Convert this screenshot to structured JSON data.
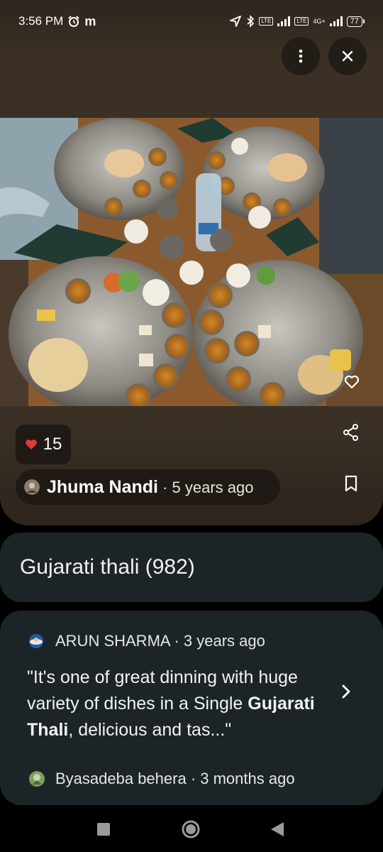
{
  "status_bar": {
    "time": "3:56 PM",
    "notification_letter": "m",
    "network_label": "4G+",
    "lte_label": "LTE",
    "battery": "77"
  },
  "top_actions": {
    "menu_icon": "more-vert-icon",
    "close_icon": "close-icon"
  },
  "photo": {
    "subject": "food-photo"
  },
  "likes": {
    "count": "15"
  },
  "author": {
    "name": "Jhuma Nandi",
    "time": " · 5 years ago"
  },
  "dish": {
    "title": "Gujarati thali (982)"
  },
  "review": {
    "reviewer": "ARUN SHARMA",
    "time": " · 3 years ago",
    "text_start": "\"It's one of great dinning with huge variety of dishes in a Single ",
    "highlight": "Gujarati Thali",
    "text_end": ", delicious and tas...\""
  },
  "next_review": {
    "reviewer": "Byasadeba behera",
    "time": " · 3 months ago"
  },
  "colors": {
    "like_heart": "#e53935",
    "card_bg": "#1d2427",
    "header_bg": "#3b3128"
  }
}
